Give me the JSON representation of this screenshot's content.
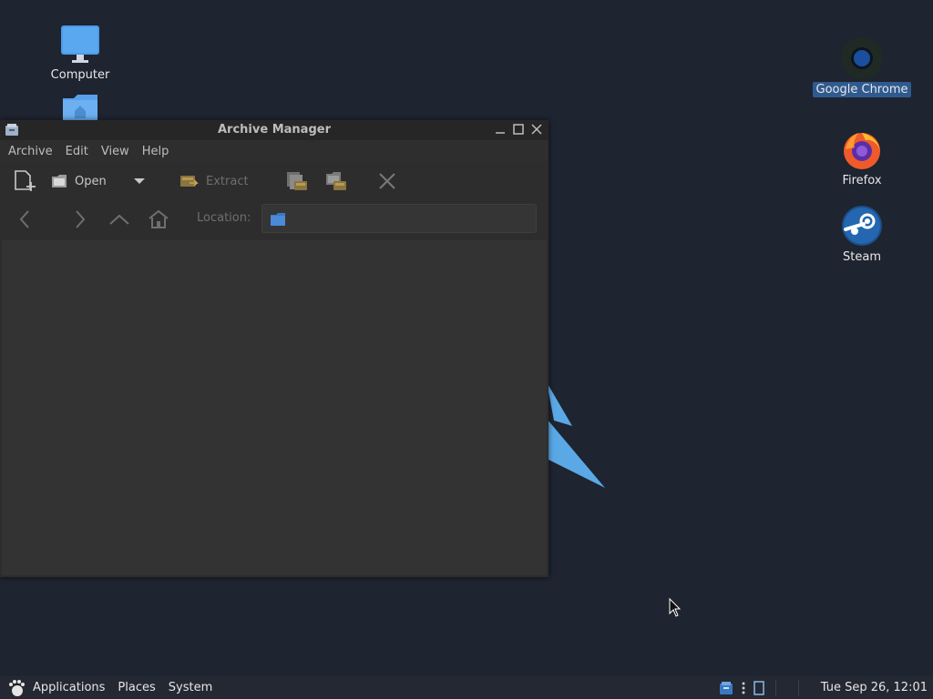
{
  "desktop": {
    "icons": [
      {
        "label": "Computer",
        "icon": "computer-icon"
      },
      {
        "label": "",
        "icon": "home-folder-icon"
      },
      {
        "label": "Google Chrome",
        "icon": "chrome-icon",
        "selected": true
      },
      {
        "label": "Firefox",
        "icon": "firefox-icon"
      },
      {
        "label": "Steam",
        "icon": "steam-icon"
      }
    ]
  },
  "window": {
    "title": "Archive Manager",
    "menu": [
      "Archive",
      "Edit",
      "View",
      "Help"
    ],
    "toolbar": {
      "new_icon": "new-archive-icon",
      "open_label": "Open",
      "extract_label": "Extract",
      "add_files_icon": "add-files-icon",
      "add_folder_icon": "add-folder-icon",
      "stop_icon": "stop-icon"
    },
    "location": {
      "label": "Location:",
      "value": ""
    }
  },
  "panel": {
    "applications": "Applications",
    "places": "Places",
    "system": "System",
    "clock": "Tue Sep 26, 12:01"
  },
  "colors": {
    "desktop_bg": "#1e2430",
    "window_bg": "#2d2d2d",
    "accent": "#5aa9e6",
    "selection": "#2f5a8f"
  }
}
